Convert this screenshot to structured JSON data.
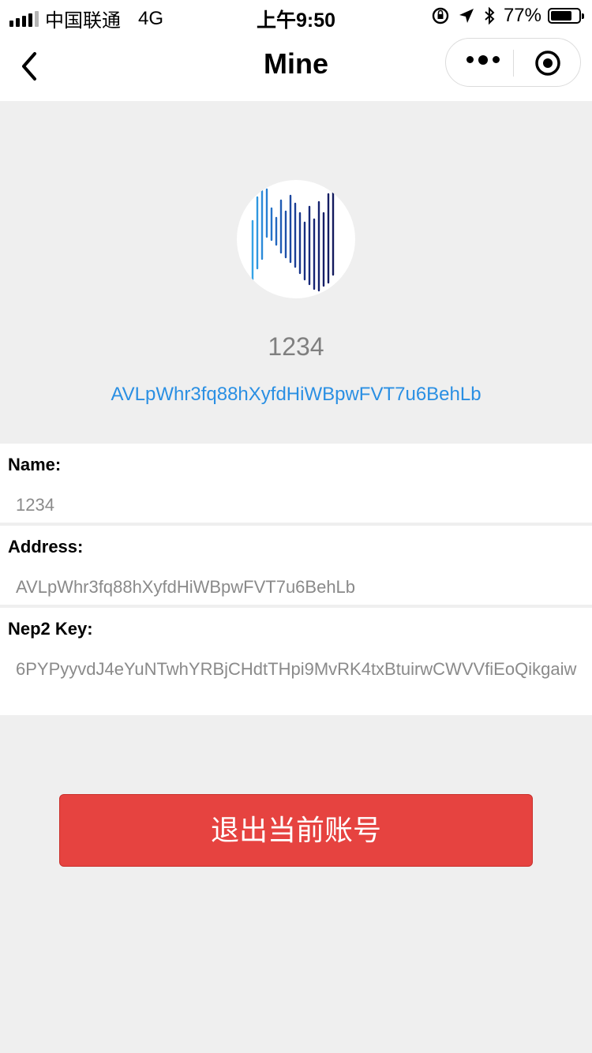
{
  "status_bar": {
    "carrier": "中国联通",
    "network": "4G",
    "time": "上午9:50",
    "battery_text": "77%",
    "battery_level": 0.77,
    "icons": [
      "orientation-lock-icon",
      "location-arrow-icon",
      "bluetooth-icon"
    ]
  },
  "nav": {
    "title": "Mine",
    "back_icon": "chevron-left-icon",
    "more_icon": "more-dots-icon",
    "close_icon": "target-circle-icon"
  },
  "profile": {
    "name": "1234",
    "address": "AVLpWhr3fq88hXyfdHiWBpwFVT7u6BehLb"
  },
  "info": {
    "name_label": "Name:",
    "name_value": "1234",
    "address_label": "Address:",
    "address_value": "AVLpWhr3fq88hXyfdHiWBpwFVT7u6BehLb",
    "key_label": "Nep2 Key:",
    "key_value": "6PYPyyvdJ4eYuNTwhYRBjCHdtTHpi9MvRK4txBtuirwCWVVfiEoQikgaiw"
  },
  "actions": {
    "logout_label": "退出当前账号"
  },
  "colors": {
    "accent_link": "#2a8fe3",
    "danger": "#e64340",
    "background": "#efefef"
  }
}
